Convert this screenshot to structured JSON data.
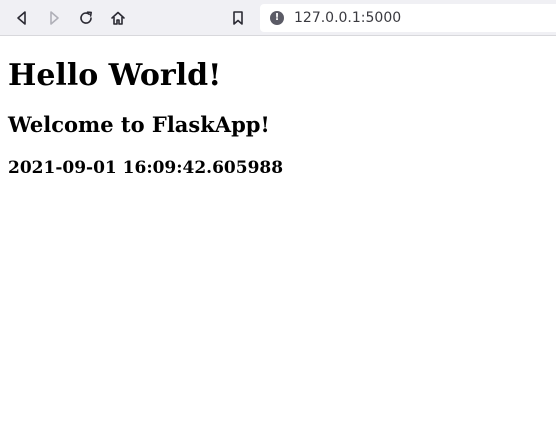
{
  "browser": {
    "url": "127.0.0.1:5000",
    "back_icon": "back-arrow-icon",
    "forward_icon": "forward-arrow-icon",
    "reload_icon": "reload-icon",
    "home_icon": "home-icon",
    "bookmark_icon": "bookmark-icon",
    "site_info_icon": "site-info-icon",
    "site_info_glyph": "!"
  },
  "page": {
    "heading1": "Hello World!",
    "heading2": "Welcome to FlaskApp!",
    "heading3": "2021-09-01 16:09:42.605988"
  },
  "colors": {
    "toolbar_bg": "#f0f0f4",
    "icon_active": "#2b2a33",
    "icon_disabled": "#b0b0b8"
  }
}
